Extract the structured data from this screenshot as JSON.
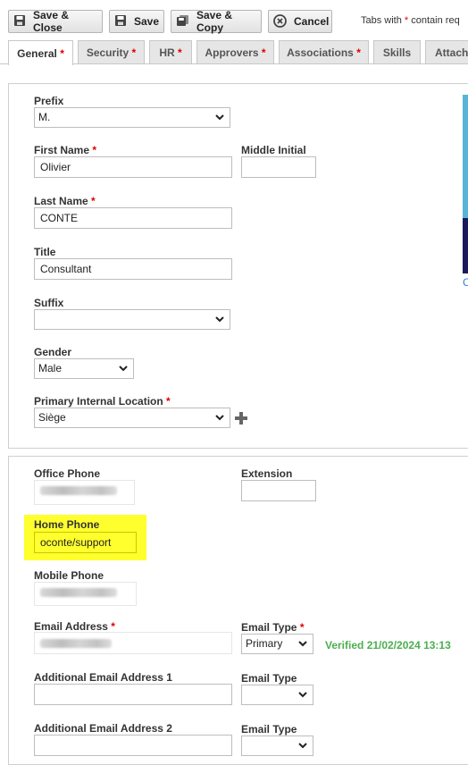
{
  "toolbar": {
    "save_close": "Save & Close",
    "save": "Save",
    "save_copy": "Save & Copy",
    "cancel": "Cancel",
    "hint_pre": "Tabs with",
    "hint_star": "*",
    "hint_post": "contain req"
  },
  "tabs": [
    {
      "label": "General",
      "required": true,
      "active": true
    },
    {
      "label": "Security",
      "required": true
    },
    {
      "label": "HR",
      "required": true
    },
    {
      "label": "Approvers",
      "required": true
    },
    {
      "label": "Associations",
      "required": true
    },
    {
      "label": "Skills",
      "required": false
    },
    {
      "label": "Attachi",
      "required": false
    }
  ],
  "required_star": "*",
  "identity": {
    "prefix": {
      "label": "Prefix",
      "value": "M."
    },
    "first_name": {
      "label": "First Name",
      "value": "Olivier"
    },
    "middle_initial": {
      "label": "Middle Initial",
      "value": ""
    },
    "last_name": {
      "label": "Last Name",
      "value": "CONTE"
    },
    "title": {
      "label": "Title",
      "value": "Consultant"
    },
    "suffix": {
      "label": "Suffix",
      "value": ""
    },
    "gender": {
      "label": "Gender",
      "value": "Male"
    },
    "location": {
      "label": "Primary Internal Location",
      "value": "Siège"
    },
    "side_link": "C"
  },
  "contact": {
    "office_phone": {
      "label": "Office Phone"
    },
    "extension": {
      "label": "Extension",
      "value": ""
    },
    "home_phone": {
      "label": "Home Phone",
      "value": "oconte/support"
    },
    "mobile_phone": {
      "label": "Mobile Phone"
    },
    "email": {
      "label": "Email Address"
    },
    "email_type": {
      "label": "Email Type",
      "value": "Primary"
    },
    "verified": "Verified 21/02/2024 13:13",
    "additional_email_1": {
      "label": "Additional Email Address 1",
      "value": ""
    },
    "email_type_1": {
      "label": "Email Type",
      "value": ""
    },
    "additional_email_2": {
      "label": "Additional Email Address 2",
      "value": ""
    },
    "email_type_2": {
      "label": "Email Type",
      "value": ""
    }
  },
  "colors": {
    "highlight": "#ffff2e",
    "verified": "#4caf50",
    "required": "#dd0000"
  }
}
